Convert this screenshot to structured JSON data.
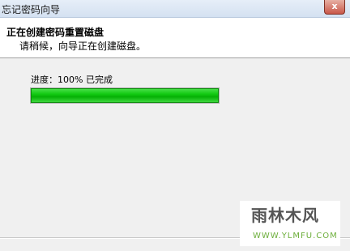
{
  "window": {
    "title": "忘记密码向导",
    "close_glyph": "x"
  },
  "header": {
    "title": "正在创建密码重置磁盘",
    "subtitle": "请稍候，向导正在创建磁盘。"
  },
  "progress": {
    "label": "进度：100% 已完成",
    "percent": 100,
    "fill_color": "#11c811"
  },
  "watermark": {
    "text": "雨林木风",
    "url": "WWW.YLMFU.COM"
  }
}
